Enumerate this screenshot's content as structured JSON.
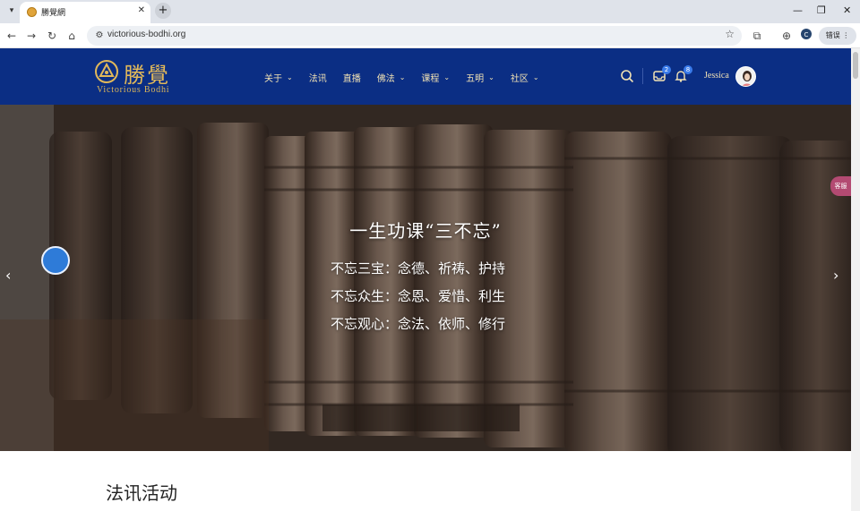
{
  "browser": {
    "tab_title": "勝覺網",
    "new_tab_symbol": "+",
    "url": "victorious-bodhi.org",
    "profile_label": "错误"
  },
  "site": {
    "logo_cn": "勝覺",
    "logo_en": "Victorious Bodhi",
    "nav": [
      {
        "label": "关于",
        "has_dropdown": true
      },
      {
        "label": "法讯",
        "has_dropdown": false
      },
      {
        "label": "直播",
        "has_dropdown": false
      },
      {
        "label": "佛法",
        "has_dropdown": true
      },
      {
        "label": "课程",
        "has_dropdown": true
      },
      {
        "label": "五明",
        "has_dropdown": true
      },
      {
        "label": "社区",
        "has_dropdown": true
      }
    ],
    "inbox_badge": "2",
    "notifications_badge": "8",
    "user_name": "Jessica"
  },
  "hero": {
    "title": "一生功课“三不忘”",
    "lines": [
      "不忘三宝：念德、祈祷、护持",
      "不忘众生：念恩、爱惜、利生",
      "不忘观心：念法、依师、修行"
    ],
    "side_chip": "客服"
  },
  "section": {
    "title": "法讯活动"
  },
  "colors": {
    "header_bg": "#0b2e84",
    "logo_gold": "#e1b85a",
    "nav_text": "#f1e2b4",
    "badge_blue": "#3a7bea"
  }
}
